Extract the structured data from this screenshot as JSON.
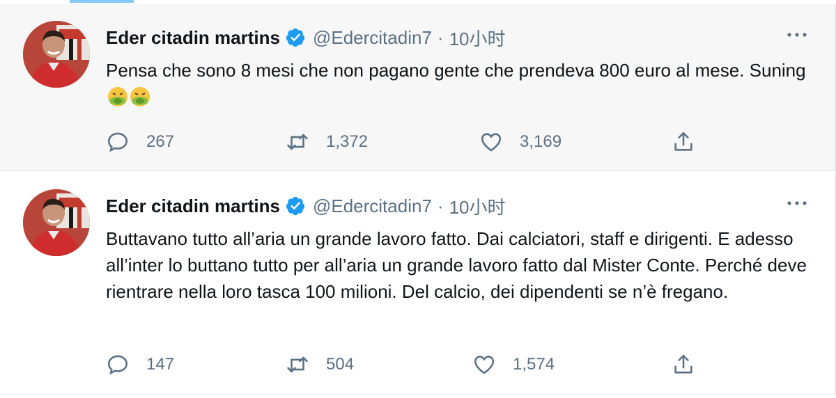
{
  "colors": {
    "accent": "#1d9bf0",
    "verified": "#1d9bf0",
    "secondary_text": "#5b7083"
  },
  "tweets": [
    {
      "author_name": "Eder citadin martins",
      "handle": "@Edercitadin7",
      "separator": "·",
      "time": "10小时",
      "text": "Pensa che sono 8 mesi che non pagano gente che prendeva 800 euro al mese. Suning",
      "emoji": [
        "nauseated-face",
        "nauseated-face"
      ],
      "replies": "267",
      "retweets": "1,372",
      "likes": "3,169"
    },
    {
      "author_name": "Eder citadin martins",
      "handle": "@Edercitadin7",
      "separator": "·",
      "time": "10小时",
      "text": "Buttavano tutto all’aria un grande lavoro fatto. Dai calciatori, staff e dirigenti. E adesso all’inter lo buttano tutto per all’aria un grande lavoro fatto dal Mister Conte. Perché deve rientrare nella loro tasca 100 milioni. Del calcio, dei dipendenti se n’è fregano.",
      "replies": "147",
      "retweets": "504",
      "likes": "1,574"
    }
  ]
}
